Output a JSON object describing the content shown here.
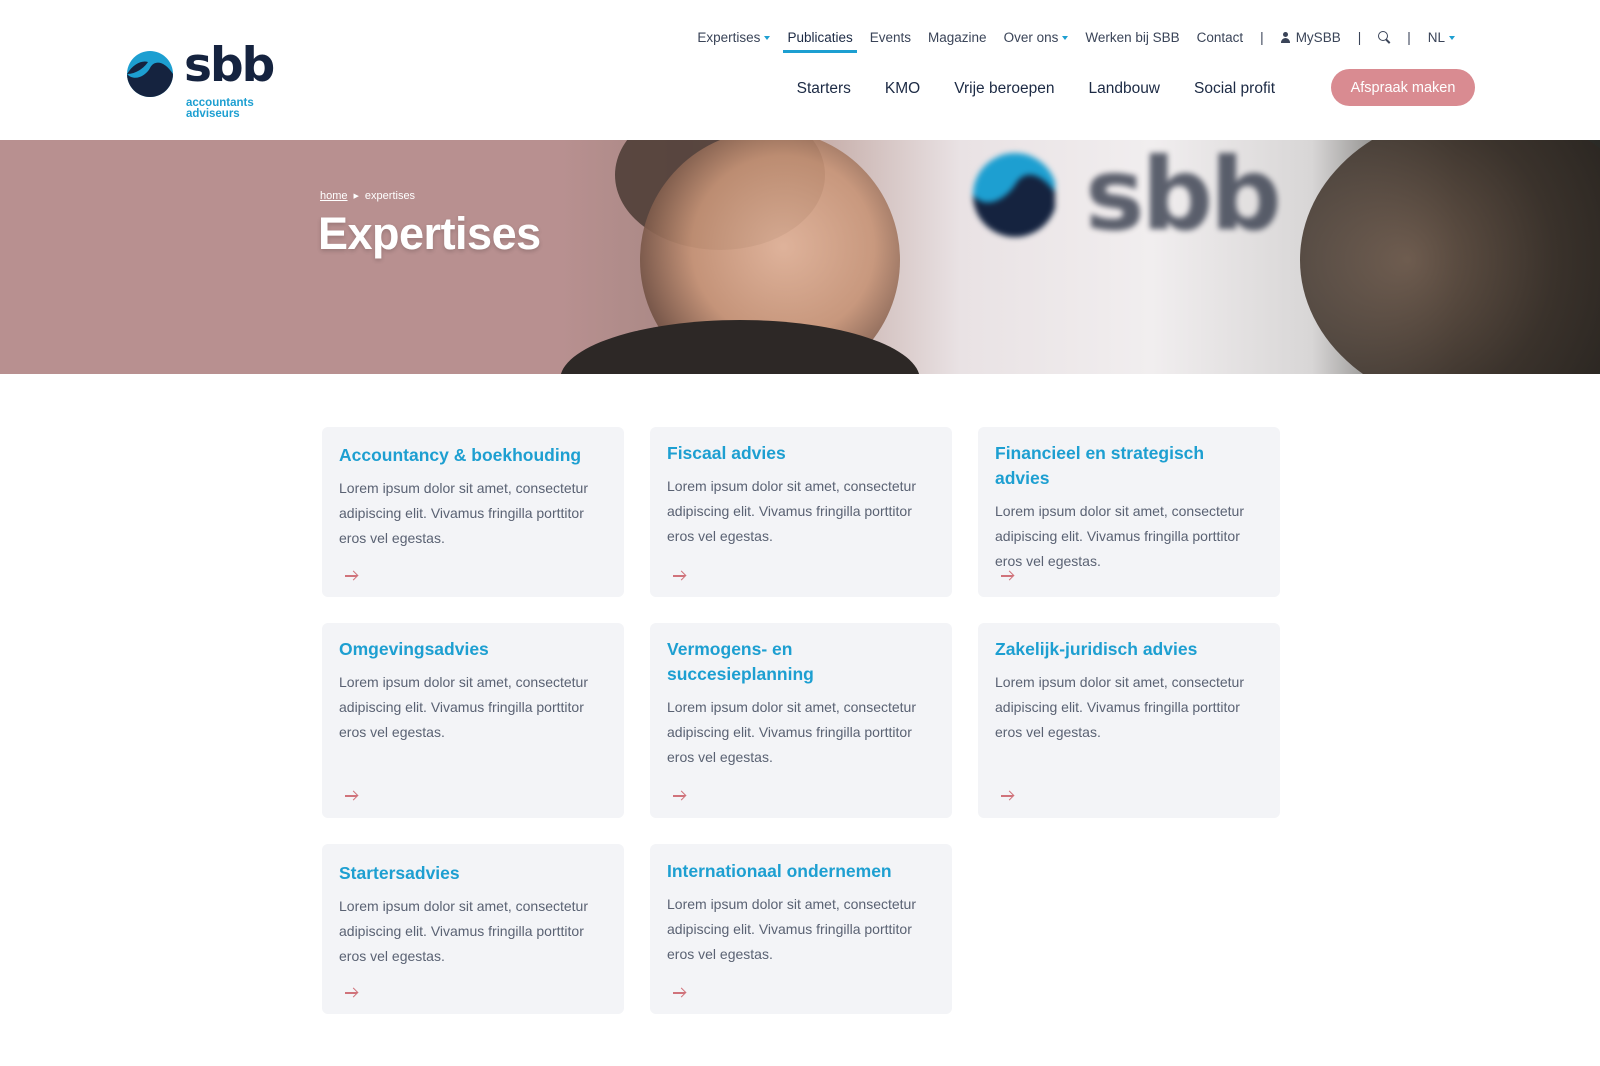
{
  "logo": {
    "word": "sbb",
    "sub1": "accountants",
    "sub2": "adviseurs"
  },
  "topnav": {
    "items": [
      "Expertises",
      "Publicaties",
      "Events",
      "Magazine",
      "Over ons",
      "Werken bij SBB",
      "Contact"
    ],
    "mysbb": "MySBB",
    "lang": "NL"
  },
  "mainnav": {
    "items": [
      "Starters",
      "KMO",
      "Vrije beroepen",
      "Landbouw",
      "Social profit"
    ]
  },
  "cta": "Afspraak maken",
  "breadcrumb": {
    "home": "home",
    "current": "expertises"
  },
  "hero": {
    "title": "Expertises"
  },
  "cards": [
    {
      "title": "Accountancy & boekhouding",
      "body": "Lorem ipsum dolor sit amet, consectetur adipiscing elit. Vivamus fringilla porttitor eros vel egestas."
    },
    {
      "title": "Fiscaal advies",
      "body": "Lorem ipsum dolor sit amet, consectetur adipiscing elit. Vivamus fringilla porttitor eros vel egestas."
    },
    {
      "title": "Financieel en strategisch advies",
      "body": "Lorem ipsum dolor sit amet, consectetur adipiscing elit. Vivamus fringilla porttitor eros vel egestas."
    },
    {
      "title": "Omgevingsadvies",
      "body": "Lorem ipsum dolor sit amet, consectetur adipiscing elit. Vivamus fringilla porttitor eros vel egestas."
    },
    {
      "title": "Vermogens- en succesieplanning",
      "body": "Lorem ipsum dolor sit amet, consectetur adipiscing elit. Vivamus fringilla porttitor eros vel egestas."
    },
    {
      "title": "Zakelijk-juridisch advies",
      "body": "Lorem ipsum dolor sit amet, consectetur adipiscing elit. Vivamus fringilla porttitor eros vel egestas."
    },
    {
      "title": "Startersadvies",
      "body": "Lorem ipsum dolor sit amet, consectetur adipiscing elit. Vivamus fringilla porttitor eros vel egestas."
    },
    {
      "title": "Internationaal ondernemen",
      "body": "Lorem ipsum dolor sit amet, consectetur adipiscing elit. Vivamus fringilla porttitor eros vel egestas."
    }
  ],
  "colors": {
    "accent": "#1d9fd1",
    "brand_dark": "#15233f",
    "cta": "#d98b91",
    "arrow": "#d0737b",
    "card_bg": "#f3f4f7"
  },
  "icons": [
    "logo-mark-icon",
    "caret-down-icon",
    "user-icon",
    "search-icon",
    "arrow-right-icon"
  ]
}
